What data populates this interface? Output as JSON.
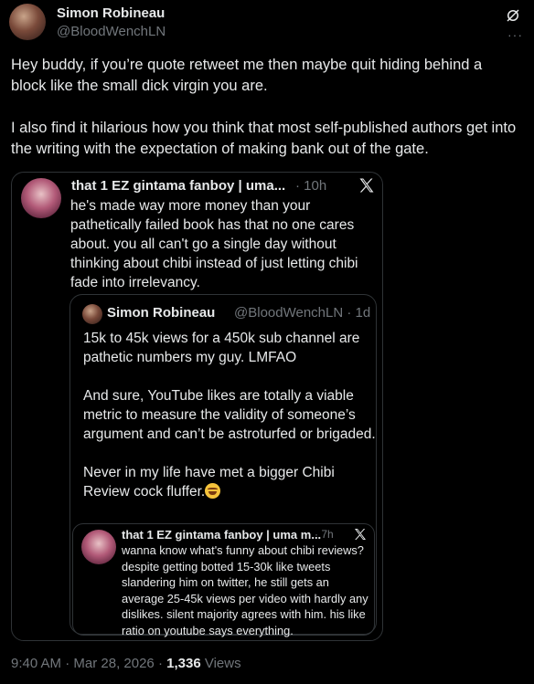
{
  "author": {
    "name": "Simon Robineau",
    "handle": "@BloodWenchLN"
  },
  "icons": {
    "grok": "grok-icon",
    "more": "more-icon",
    "x": "x-logo-icon"
  },
  "tweet": {
    "paragraphs": [
      "Hey buddy, if you’re quote retweet me then maybe quit hiding behind a block like the small dick virgin you are.",
      "I also find it hilarious how you think that most self-published authors get into the writing with the expectation of making bank out of the gate."
    ]
  },
  "quote1": {
    "name": "that 1 EZ gintama fanboy | uma...",
    "time": "· 10h",
    "text": "he's made way more money than your pathetically failed book has that no one cares about. you all can't go a single day without thinking about chibi instead of just letting chibi fade into irrelevancy."
  },
  "quote2": {
    "name": "Simon Robineau",
    "handle_time": "@BloodWenchLN · 1d",
    "paragraphs": [
      "15k to 45k views for a 450k sub channel are pathetic numbers my guy. LMFAO",
      "And sure, YouTube likes are totally a viable metric to measure the validity of someone’s argument and can’t be astroturfed or brigaded.",
      "Never in my life have met a bigger Chibi Review cock fluffer."
    ],
    "emoji": "rolling-on-floor-laughing-emoji"
  },
  "quote3": {
    "name": "that 1 EZ gintama fanboy | uma m...",
    "time": "· 7h",
    "text": "wanna know what's funny about chibi reviews? despite getting botted 15-30k like tweets slandering him on twitter, he still gets an average 25-45k views per video with hardly any dislikes. silent majority agrees with him. his like ratio on youtube says everything."
  },
  "meta": {
    "time": "9:40 AM",
    "sep1": " · ",
    "date": "Mar 28, 2026",
    "sep2": " · ",
    "views_count": "1,336",
    "views_label": " Views"
  }
}
